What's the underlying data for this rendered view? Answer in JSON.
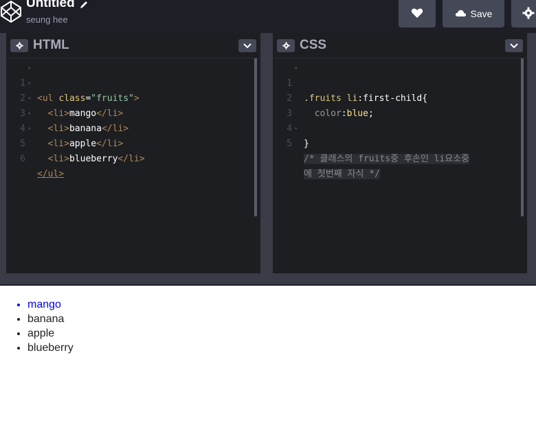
{
  "header": {
    "title": "Untitled",
    "subtitle": "seung hee",
    "save_label": "Save"
  },
  "html_pane": {
    "title": "HTML",
    "line_numbers": [
      "1",
      "2",
      "3",
      "4",
      "5",
      "6"
    ],
    "code": {
      "l1_open": "<ul ",
      "l1_attr": "class",
      "l1_eq": "=",
      "l1_str": "\"fruits\"",
      "l1_close": ">",
      "li_open": "<li>",
      "li_close": "</li>",
      "item1": "mango",
      "item2": "banana",
      "item3": "apple",
      "item4": "blueberry",
      "ul_close": "</ul>"
    }
  },
  "css_pane": {
    "title": "CSS",
    "line_numbers": [
      "1",
      "2",
      "3",
      "4",
      "5"
    ],
    "code": {
      "selector": ".fruits li",
      "pseudo": ":first-child",
      "brace_open": "{",
      "prop": "color",
      "colon": ":",
      "value": "blue",
      "semi": ";",
      "brace_close": "}",
      "comment_1": "/* 클래스의 fruits중 후손인 li요소중",
      "comment_2": "에 첫번째 자식 */"
    }
  },
  "preview": {
    "items": [
      "mango",
      "banana",
      "apple",
      "blueberry"
    ]
  },
  "colors": {
    "header_bg": "#1e1f26",
    "editor_bg": "#1d1e22",
    "button_bg": "#444857",
    "first_child_color": "#0000ee"
  }
}
